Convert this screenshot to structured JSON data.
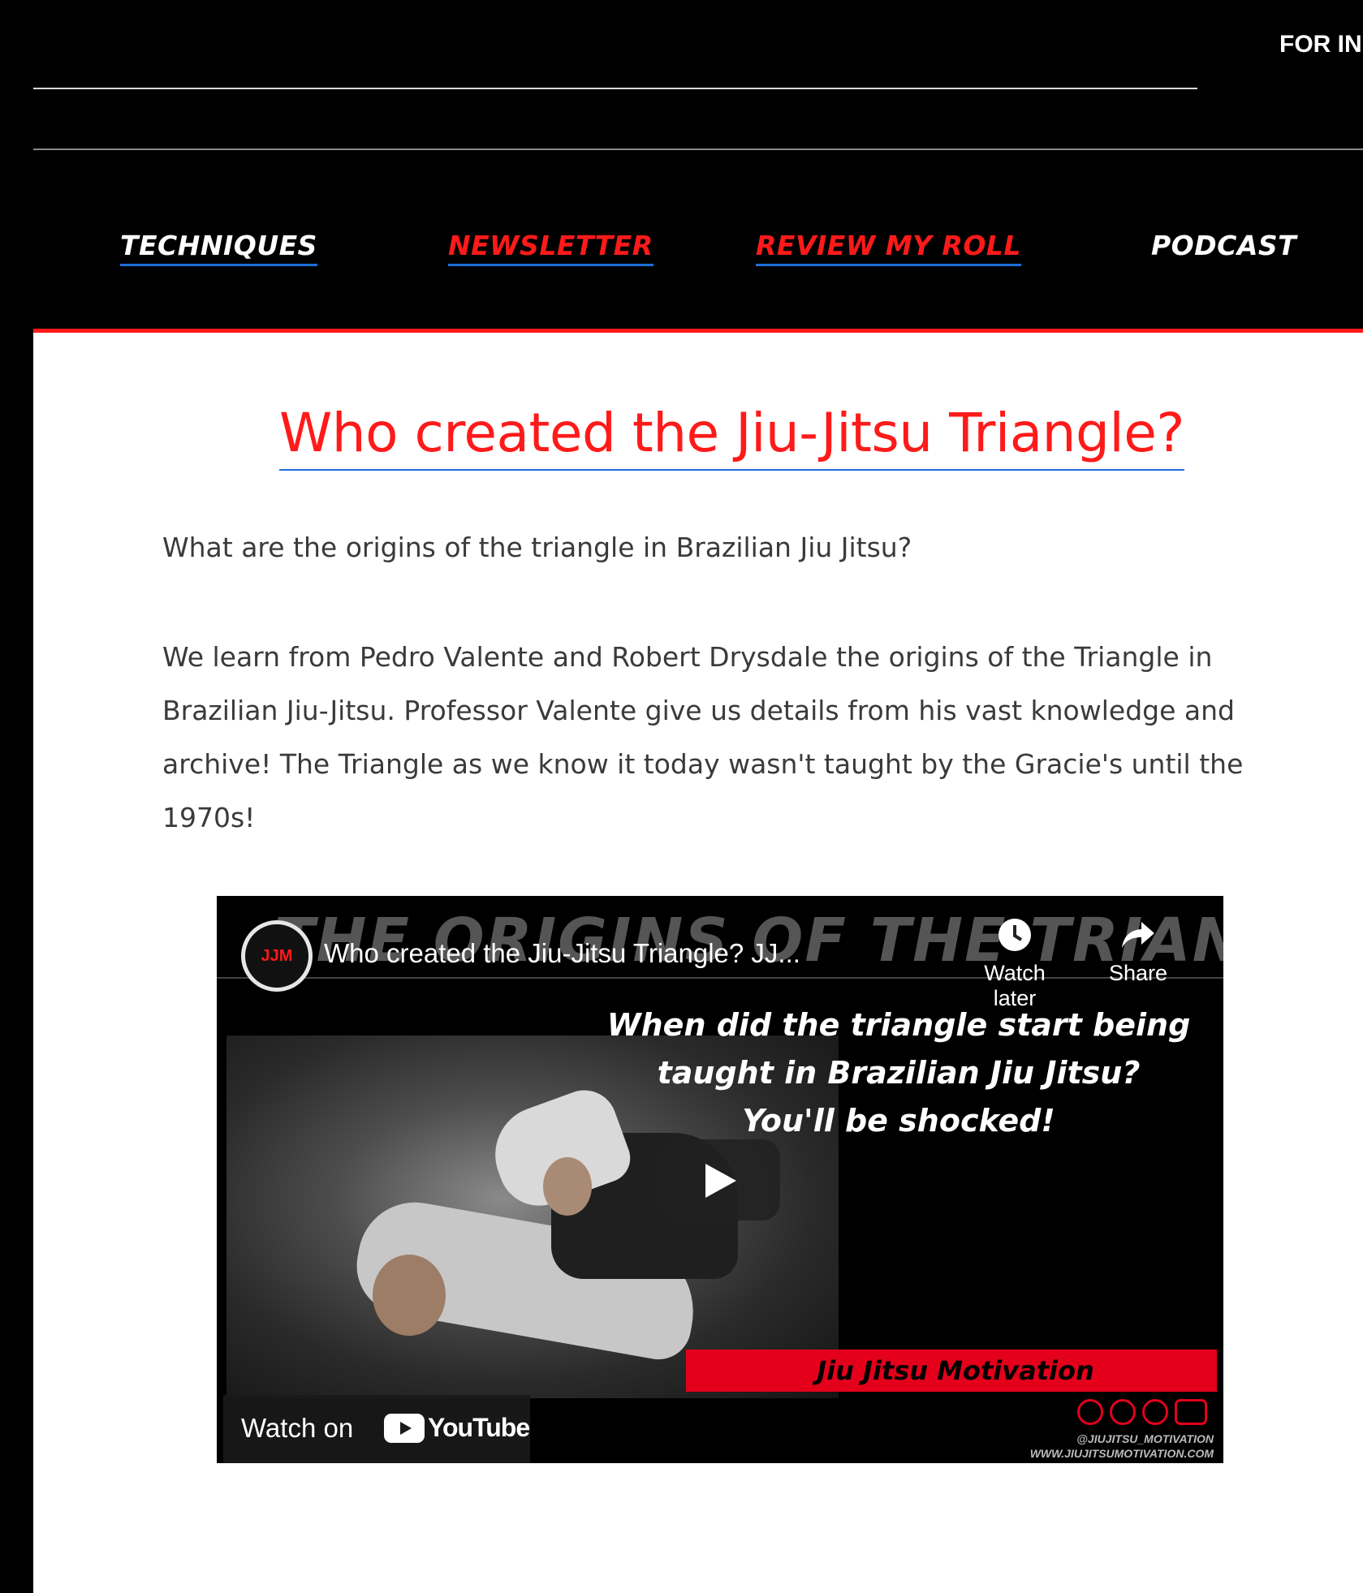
{
  "header": {
    "top_link": "FOR IN"
  },
  "nav": {
    "items": [
      {
        "label": "TECHNIQUES",
        "color": "#ffffff"
      },
      {
        "label": "NEWSLETTER",
        "color": "#ff1a1a"
      },
      {
        "label": "REVIEW MY ROLL",
        "color": "#ff1a1a"
      },
      {
        "label": "PODCAST",
        "color": "#ffffff"
      }
    ]
  },
  "article": {
    "title": "Who created the Jiu-Jitsu Triangle?",
    "subtitle_question": "What are the origins of the triangle in Brazilian Jiu Jitsu?",
    "body": "We learn from Pedro Valente and Robert Drysdale the origins of the Triangle in Brazilian Jiu-Jitsu. Professor Valente give us details from his vast knowledge and archive! The Triangle as we know it today wasn't taught by the Gracie's until the 1970s!"
  },
  "video": {
    "channel_logo_text": "JJM",
    "big_overlay_title": "THE ORIGINS OF THE TRIANGLE",
    "title": "Who created the Jiu-Jitsu Triangle? JJ...",
    "watch_later_label": "Watch later",
    "share_label": "Share",
    "caption_line1": "When did the triangle start being",
    "caption_line2": "taught in Brazilian Jiu Jitsu?",
    "caption_line3": "You'll be shocked!",
    "banner": "Jiu Jitsu Motivation",
    "watch_on_label": "Watch on",
    "youtube_label": "YouTube",
    "footer_handle": "@JIUJITSU_MOTIVATION",
    "footer_site": "WWW.JIUJITSUMOTIVATION.COM"
  },
  "colors": {
    "accent_red": "#ff1a1a",
    "link_underline": "#1e6fd9",
    "background": "#000000",
    "content_bg": "#ffffff"
  }
}
